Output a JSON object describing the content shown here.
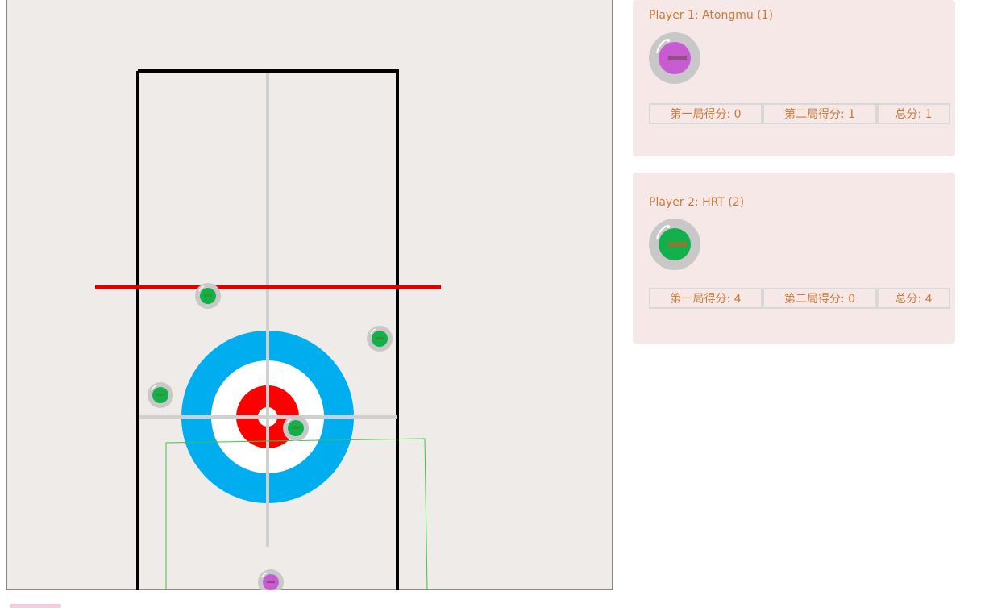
{
  "players": [
    {
      "name": "Player 1: Atongmu (1)",
      "stone_color": "#c75bd2",
      "scores": [
        "第一局得分: 0",
        "第二局得分: 1",
        "总分: 1"
      ]
    },
    {
      "name": "Player 2: HRT (2)",
      "stone_color": "#12b04b",
      "scores": [
        "第一局得分: 4",
        "第二局得分: 0",
        "总分: 4"
      ]
    }
  ],
  "sheet": {
    "ice_color": "#efebe8",
    "house_colors": {
      "outer": "#00adef",
      "middle": "#ffffff",
      "inner": "#ff0000",
      "button": "#ffffff"
    },
    "hog_line_color": "#e10000",
    "center_line_color": "#d0d0d0",
    "aim_box_color": "#3ec33e"
  },
  "stones": [
    {
      "team": "green",
      "icon": "curling-stone-green"
    },
    {
      "team": "green",
      "icon": "curling-stone-green"
    },
    {
      "team": "green",
      "icon": "curling-stone-green"
    },
    {
      "team": "green",
      "icon": "curling-stone-green"
    },
    {
      "team": "purple",
      "icon": "curling-stone-purple"
    }
  ]
}
